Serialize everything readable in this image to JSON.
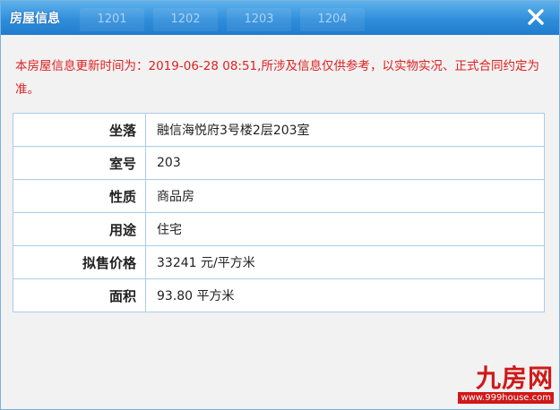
{
  "dialog": {
    "title": "房屋信息",
    "ghost_tabs": [
      "1201",
      "1202",
      "1203",
      "1204"
    ],
    "close_icon": "close-icon"
  },
  "notice": "本房屋信息更新时间为：2019-06-28 08:51,所涉及信息仅供参考，以实物实况、正式合同约定为准。",
  "table": {
    "rows": [
      {
        "label": "坐落",
        "value": "融信海悦府3号楼2层203室"
      },
      {
        "label": "室号",
        "value": "203"
      },
      {
        "label": "性质",
        "value": "商品房"
      },
      {
        "label": "用途",
        "value": "住宅"
      },
      {
        "label": "拟售价格",
        "value": "33241 元/平方米"
      },
      {
        "label": "面积",
        "value": "93.80 平方米"
      }
    ]
  },
  "logo": {
    "text": "九房网",
    "url": "www.999house.com"
  },
  "colors": {
    "titlebar": "#2f8edb",
    "notice_text": "#e02020",
    "table_border": "#a9cce9",
    "logo": "#d01818"
  }
}
